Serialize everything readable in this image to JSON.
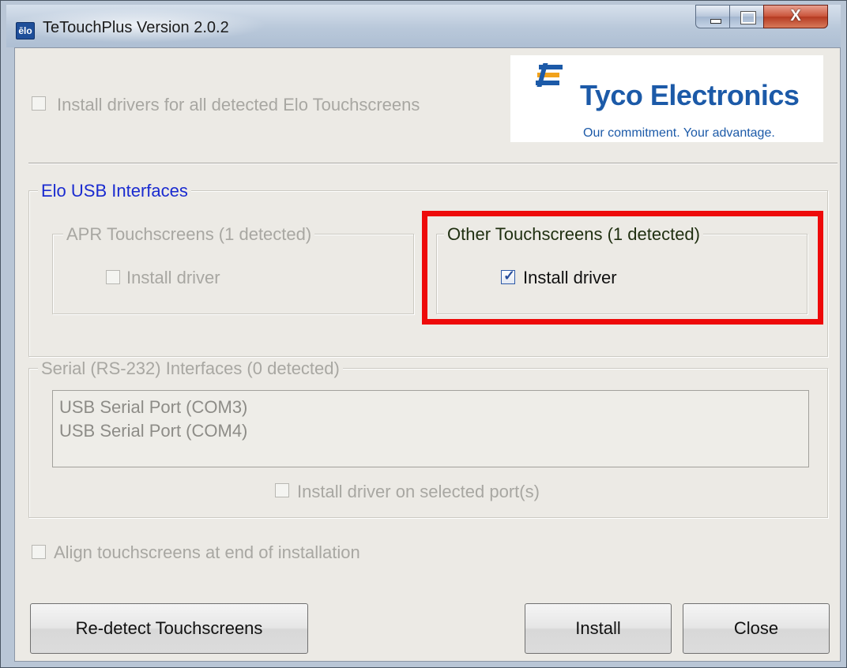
{
  "window": {
    "title": "TeTouchPlus Version 2.0.2",
    "app_icon_text": "ēlo",
    "close_glyph": "X"
  },
  "logo": {
    "name": "Tyco Electronics",
    "tagline": "Our commitment. Your advantage.",
    "colors": {
      "blue": "#1c5aa8",
      "orange": "#f2a21b"
    }
  },
  "install_all": {
    "label": "Install drivers for all detected Elo Touchscreens",
    "checked": false,
    "enabled": false
  },
  "usb": {
    "legend": "Elo USB Interfaces",
    "apr": {
      "legend": "APR Touchscreens (1 detected)",
      "checkbox_label": "Install driver",
      "checked": false,
      "enabled": false
    },
    "other": {
      "legend": "Other Touchscreens (1 detected)",
      "checkbox_label": "Install driver",
      "checked": true,
      "enabled": true
    }
  },
  "serial": {
    "legend": "Serial (RS-232) Interfaces (0 detected)",
    "ports": [
      "USB Serial Port (COM3)",
      "USB Serial Port (COM4)"
    ],
    "checkbox_label": "Install driver on selected port(s)",
    "checked": false
  },
  "align": {
    "label": "Align touchscreens at end of installation",
    "checked": false
  },
  "buttons": {
    "redetect": "Re-detect Touchscreens",
    "install": "Install",
    "close": "Close"
  },
  "highlight_color": "#ee0a0a"
}
